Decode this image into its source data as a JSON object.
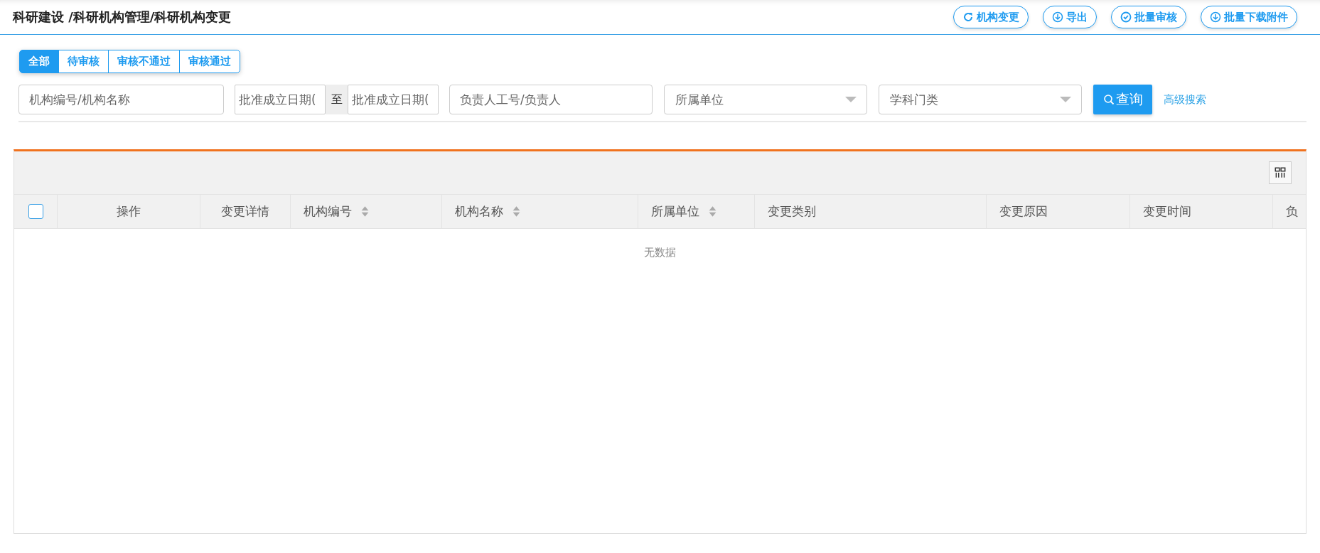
{
  "breadcrumb": "科研建设 /科研机构管理/科研机构变更",
  "actions": [
    {
      "label": "机构变更",
      "kind": "refresh"
    },
    {
      "label": "导出",
      "kind": "download"
    },
    {
      "label": "批量审核",
      "kind": "approve"
    },
    {
      "label": "批量下载附件",
      "kind": "download"
    }
  ],
  "tabs": [
    {
      "label": "全部",
      "selected": true
    },
    {
      "label": "待审核",
      "selected": false
    },
    {
      "label": "审核不通过",
      "selected": false
    },
    {
      "label": "审核通过",
      "selected": false
    }
  ],
  "filters": {
    "keyword": {
      "placeholder": "机构编号/机构名称"
    },
    "date_from": {
      "placeholder": "批准成立日期("
    },
    "date_separator": "至",
    "date_to": {
      "placeholder": "批准成立日期("
    },
    "leader": {
      "placeholder": "负责人工号/负责人"
    },
    "unit": {
      "placeholder": "所属单位"
    },
    "discipline": {
      "placeholder": "学科门类"
    },
    "search_button": "查询",
    "advanced_link": "高级搜索"
  },
  "table": {
    "select_all": {
      "checked": false
    },
    "columns": [
      {
        "label": "操作",
        "sortable": false
      },
      {
        "label": "变更详情",
        "sortable": false
      },
      {
        "label": "机构编号",
        "sortable": true
      },
      {
        "label": "机构名称",
        "sortable": true
      },
      {
        "label": "所属单位",
        "sortable": true
      },
      {
        "label": "变更类别",
        "sortable": false
      },
      {
        "label": "变更原因",
        "sortable": false
      },
      {
        "label": "变更时间",
        "sortable": false
      },
      {
        "label": "负"
      }
    ],
    "empty_text": "无数据"
  }
}
